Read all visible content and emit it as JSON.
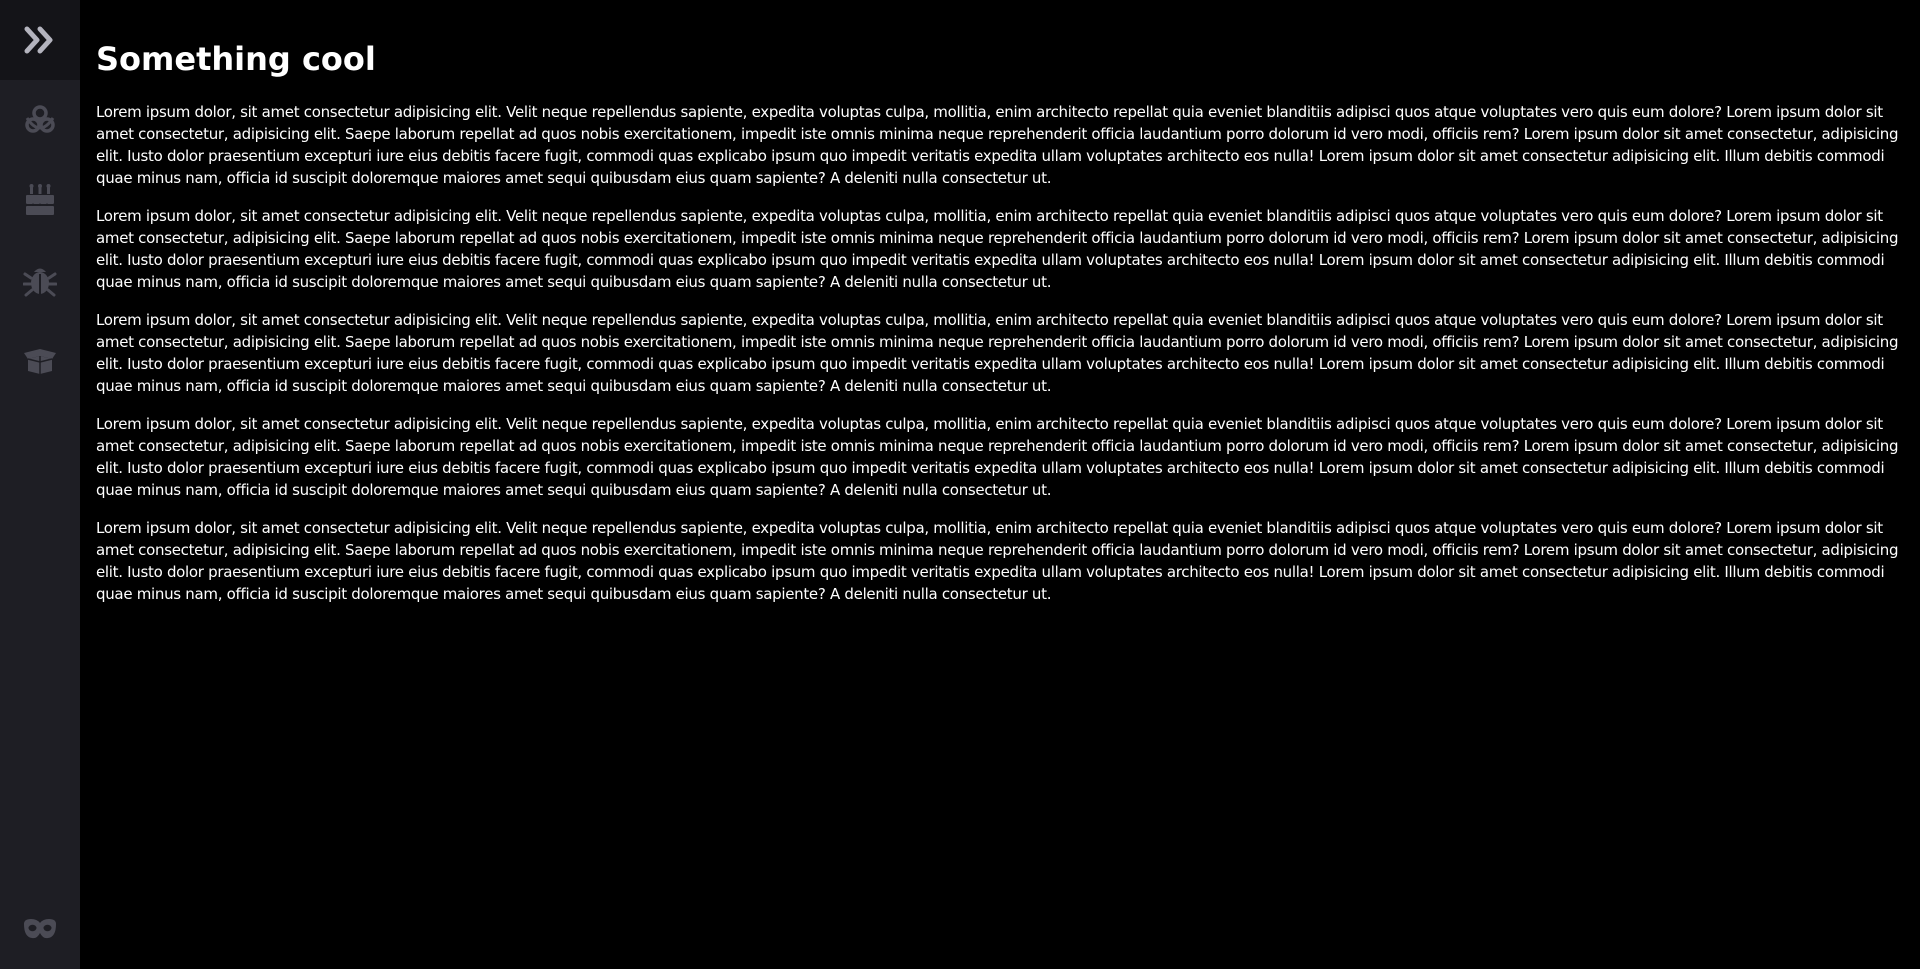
{
  "navbar": {
    "toggle_icon": "double-chevron-right-icon",
    "items": [
      {
        "icon": "biohazard-icon"
      },
      {
        "icon": "birthday-cake-icon"
      },
      {
        "icon": "bug-icon"
      },
      {
        "icon": "open-box-icon"
      }
    ],
    "bottom_icon": "domino-mask-icon",
    "colors": {
      "background": "#1e1e24",
      "toggle_background": "#141418",
      "icon": "#4b4b55",
      "toggle_icon": "#b4b4be"
    }
  },
  "main": {
    "title": "Something cool",
    "paragraphs": [
      "Lorem ipsum dolor, sit amet consectetur adipisicing elit. Velit neque repellendus sapiente, expedita voluptas culpa, mollitia, enim architecto repellat quia eveniet blanditiis adipisci quos atque voluptates vero quis eum dolore? Lorem ipsum dolor sit amet consectetur, adipisicing elit. Saepe laborum repellat ad quos nobis exercitationem, impedit iste omnis minima neque reprehenderit officia laudantium porro dolorum id vero modi, officiis rem? Lorem ipsum dolor sit amet consectetur, adipisicing elit. Iusto dolor praesentium excepturi iure eius debitis facere fugit, commodi quas explicabo ipsum quo impedit veritatis expedita ullam voluptates architecto eos nulla! Lorem ipsum dolor sit amet consectetur adipisicing elit. Illum debitis commodi quae minus nam, officia id suscipit doloremque maiores amet sequi quibusdam eius quam sapiente? A deleniti nulla consectetur ut.",
      "Lorem ipsum dolor, sit amet consectetur adipisicing elit. Velit neque repellendus sapiente, expedita voluptas culpa, mollitia, enim architecto repellat quia eveniet blanditiis adipisci quos atque voluptates vero quis eum dolore? Lorem ipsum dolor sit amet consectetur, adipisicing elit. Saepe laborum repellat ad quos nobis exercitationem, impedit iste omnis minima neque reprehenderit officia laudantium porro dolorum id vero modi, officiis rem? Lorem ipsum dolor sit amet consectetur, adipisicing elit. Iusto dolor praesentium excepturi iure eius debitis facere fugit, commodi quas explicabo ipsum quo impedit veritatis expedita ullam voluptates architecto eos nulla! Lorem ipsum dolor sit amet consectetur adipisicing elit. Illum debitis commodi quae minus nam, officia id suscipit doloremque maiores amet sequi quibusdam eius quam sapiente? A deleniti nulla consectetur ut.",
      "Lorem ipsum dolor, sit amet consectetur adipisicing elit. Velit neque repellendus sapiente, expedita voluptas culpa, mollitia, enim architecto repellat quia eveniet blanditiis adipisci quos atque voluptates vero quis eum dolore? Lorem ipsum dolor sit amet consectetur, adipisicing elit. Saepe laborum repellat ad quos nobis exercitationem, impedit iste omnis minima neque reprehenderit officia laudantium porro dolorum id vero modi, officiis rem? Lorem ipsum dolor sit amet consectetur, adipisicing elit. Iusto dolor praesentium excepturi iure eius debitis facere fugit, commodi quas explicabo ipsum quo impedit veritatis expedita ullam voluptates architecto eos nulla! Lorem ipsum dolor sit amet consectetur adipisicing elit. Illum debitis commodi quae minus nam, officia id suscipit doloremque maiores amet sequi quibusdam eius quam sapiente? A deleniti nulla consectetur ut.",
      "Lorem ipsum dolor, sit amet consectetur adipisicing elit. Velit neque repellendus sapiente, expedita voluptas culpa, mollitia, enim architecto repellat quia eveniet blanditiis adipisci quos atque voluptates vero quis eum dolore? Lorem ipsum dolor sit amet consectetur, adipisicing elit. Saepe laborum repellat ad quos nobis exercitationem, impedit iste omnis minima neque reprehenderit officia laudantium porro dolorum id vero modi, officiis rem? Lorem ipsum dolor sit amet consectetur, adipisicing elit. Iusto dolor praesentium excepturi iure eius debitis facere fugit, commodi quas explicabo ipsum quo impedit veritatis expedita ullam voluptates architecto eos nulla! Lorem ipsum dolor sit amet consectetur adipisicing elit. Illum debitis commodi quae minus nam, officia id suscipit doloremque maiores amet sequi quibusdam eius quam sapiente? A deleniti nulla consectetur ut.",
      "Lorem ipsum dolor, sit amet consectetur adipisicing elit. Velit neque repellendus sapiente, expedita voluptas culpa, mollitia, enim architecto repellat quia eveniet blanditiis adipisci quos atque voluptates vero quis eum dolore? Lorem ipsum dolor sit amet consectetur, adipisicing elit. Saepe laborum repellat ad quos nobis exercitationem, impedit iste omnis minima neque reprehenderit officia laudantium porro dolorum id vero modi, officiis rem? Lorem ipsum dolor sit amet consectetur, adipisicing elit. Iusto dolor praesentium excepturi iure eius debitis facere fugit, commodi quas explicabo ipsum quo impedit veritatis expedita ullam voluptates architecto eos nulla! Lorem ipsum dolor sit amet consectetur adipisicing elit. Illum debitis commodi quae minus nam, officia id suscipit doloremque maiores amet sequi quibusdam eius quam sapiente? A deleniti nulla consectetur ut."
    ]
  }
}
